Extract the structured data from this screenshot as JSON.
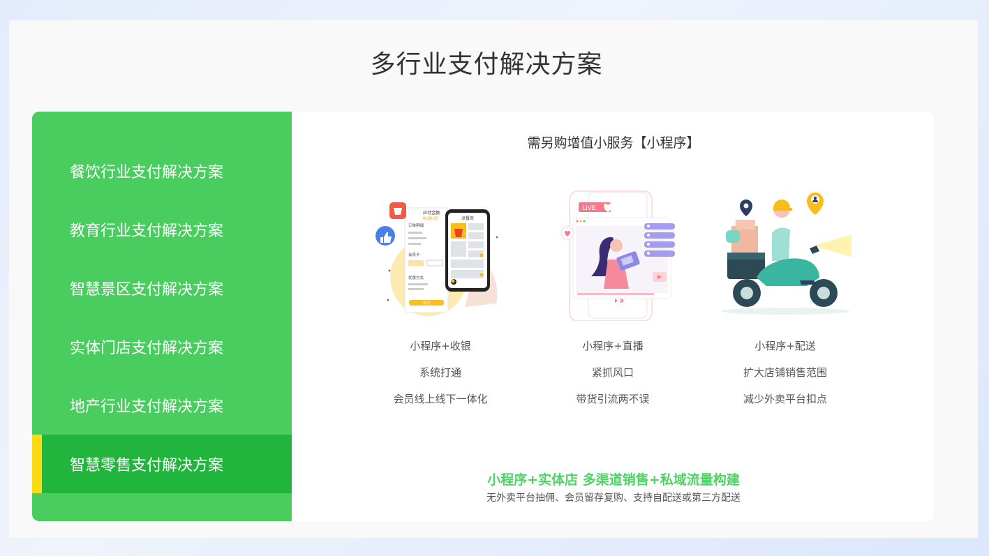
{
  "page": {
    "title": "多行业支付解决方案"
  },
  "sidebar": {
    "items": [
      {
        "label": "餐饮行业支付解决方案"
      },
      {
        "label": "教育行业支付解决方案"
      },
      {
        "label": "智慧景区支付解决方案"
      },
      {
        "label": "实体门店支付解决方案"
      },
      {
        "label": "地产行业支付解决方案"
      },
      {
        "label": "智慧零售支付解决方案"
      }
    ],
    "active_index": 5
  },
  "content": {
    "subtitle": "需另购增值小服务【小程序】",
    "cards": [
      {
        "line1": "小程序+收银",
        "line2": "系统打通",
        "line3": "会员线上线下一体化",
        "illustration": "mini-program-cashier-illustration"
      },
      {
        "line1": "小程序+直播",
        "line2": "紧抓风口",
        "line3": "带货引流两不误",
        "illustration": "mini-program-livestream-illustration"
      },
      {
        "line1": "小程序+配送",
        "line2": "扩大店铺销售范围",
        "line3": "减少外卖平台扣点",
        "illustration": "mini-program-delivery-illustration"
      }
    ],
    "illustration_text": {
      "pay_amount": "应付金额",
      "amount": "¥100.00",
      "order_info": "订单明细",
      "member_card": "会员卡",
      "discount": "优惠方式",
      "pay_button": "支付",
      "phone_title": "点餐页",
      "live_tag": "LIVE"
    },
    "footer": {
      "main": "小程序+实体店 多渠道销售+私域流量构建",
      "sub": "无外卖平台抽佣、会员留存复购、支持自配送或第三方配送"
    }
  },
  "colors": {
    "sidebar": "#49cd5f",
    "active": "#22b53d",
    "accent": "#fadb14",
    "highlight_text": "#4fd266"
  }
}
